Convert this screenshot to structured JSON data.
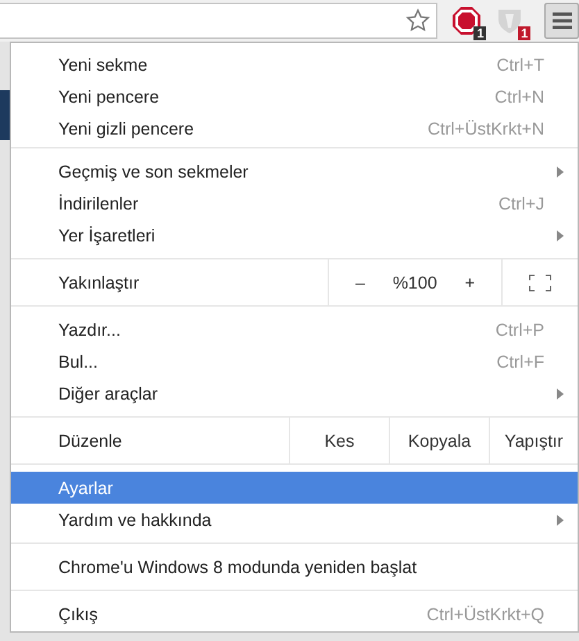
{
  "toolbar": {
    "extensions": [
      {
        "badge": "1"
      },
      {
        "badge": "1"
      }
    ]
  },
  "menu": {
    "sections": [
      {
        "items": [
          {
            "kind": "item",
            "label": "Yeni sekme",
            "shortcut": "Ctrl+T",
            "submenu": false,
            "selected": false
          },
          {
            "kind": "item",
            "label": "Yeni pencere",
            "shortcut": "Ctrl+N",
            "submenu": false,
            "selected": false
          },
          {
            "kind": "item",
            "label": "Yeni gizli pencere",
            "shortcut": "Ctrl+ÜstKrkt+N",
            "submenu": false,
            "selected": false
          }
        ]
      },
      {
        "items": [
          {
            "kind": "item",
            "label": "Geçmiş ve son sekmeler",
            "submenu": true,
            "selected": false
          },
          {
            "kind": "item",
            "label": "İndirilenler",
            "shortcut": "Ctrl+J",
            "submenu": false,
            "selected": false
          },
          {
            "kind": "item",
            "label": "Yer İşaretleri",
            "submenu": true,
            "selected": false
          }
        ]
      },
      {
        "items": [
          {
            "kind": "zoom",
            "label": "Yakınlaştır",
            "minus": "–",
            "value": "%100",
            "plus": "+"
          }
        ]
      },
      {
        "items": [
          {
            "kind": "item",
            "label": "Yazdır...",
            "shortcut": "Ctrl+P",
            "submenu": false,
            "selected": false
          },
          {
            "kind": "item",
            "label": "Bul...",
            "shortcut": "Ctrl+F",
            "submenu": false,
            "selected": false
          },
          {
            "kind": "item",
            "label": "Diğer araçlar",
            "submenu": true,
            "selected": false
          }
        ]
      },
      {
        "items": [
          {
            "kind": "edit",
            "label": "Düzenle",
            "buttons": [
              "Kes",
              "Kopyala",
              "Yapıştır"
            ]
          }
        ]
      },
      {
        "items": [
          {
            "kind": "item",
            "label": "Ayarlar",
            "submenu": false,
            "selected": true
          },
          {
            "kind": "item",
            "label": "Yardım ve hakkında",
            "submenu": true,
            "selected": false
          }
        ]
      },
      {
        "items": [
          {
            "kind": "item",
            "label": "Chrome'u Windows 8 modunda yeniden başlat",
            "submenu": false,
            "selected": false
          }
        ]
      },
      {
        "items": [
          {
            "kind": "item",
            "label": "Çıkış",
            "shortcut": "Ctrl+ÜstKrkt+Q",
            "submenu": false,
            "selected": false
          }
        ]
      }
    ]
  }
}
